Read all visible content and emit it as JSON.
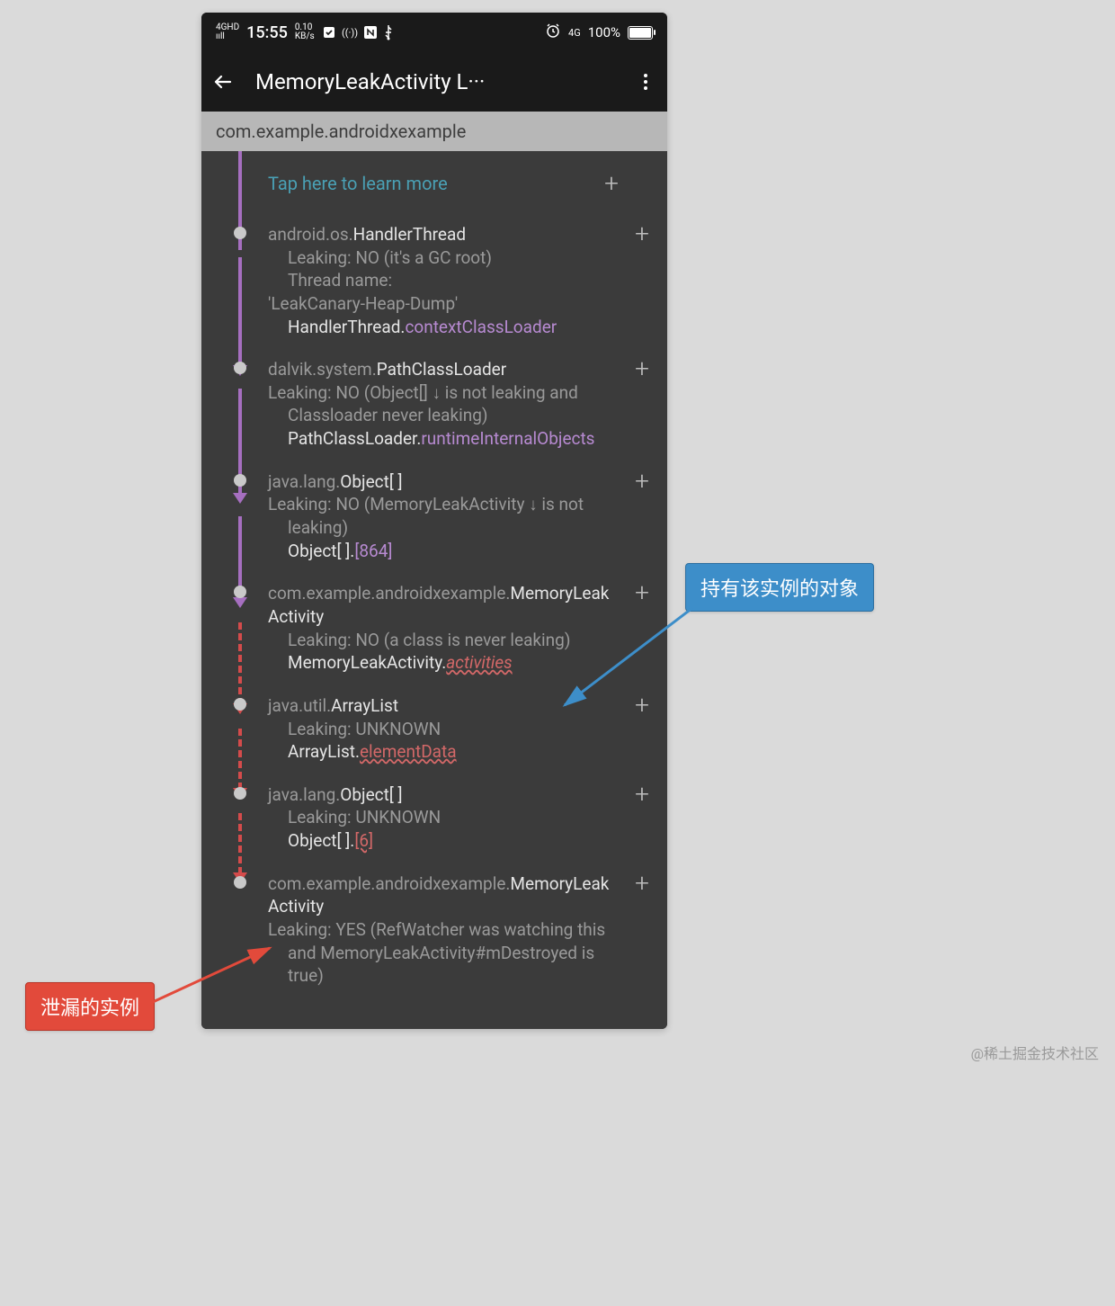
{
  "status": {
    "signal": "4GHD",
    "bars": "ııll",
    "time": "15:55",
    "speed_top": "0.10",
    "speed_bot": "KB/s",
    "net_label": "4G",
    "battery_pct": "100%"
  },
  "appbar": {
    "title": "MemoryLeakActivity L···"
  },
  "package": "com.example.androidxexample",
  "learn_more": "Tap here to learn more",
  "nodes": [
    {
      "pkg": "android.os.",
      "cls": "HandlerThread",
      "leak": "Leaking: NO (it's a GC root)",
      "extra1": "Thread name:",
      "extra2": "'LeakCanary-Heap-Dump'",
      "ref_cls": "HandlerThread.",
      "ref_field": "contextClassLoader",
      "ref_style": "purple"
    },
    {
      "pkg": "dalvik.system.",
      "cls": "PathClassLoader",
      "leak": "Leaking: NO (Object[] ↓ is not leaking and Classloader never leaking)",
      "ref_cls": "PathClassLoader.",
      "ref_field": "runtimeInternalObjects",
      "ref_style": "purple",
      "ref_wrap": true
    },
    {
      "pkg": "java.lang.",
      "cls": "Object[ ]",
      "leak": "Leaking: NO (MemoryLeakActivity ↓ is not leaking)",
      "ref_cls": "Object[ ].",
      "ref_field": "[864]",
      "ref_style": "idx-purple"
    },
    {
      "pkg": "com.example.androidxexample.",
      "cls": "MemoryLeakActivity",
      "leak": "Leaking: NO (a class is never leaking)",
      "ref_cls": "MemoryLeakActivity.",
      "ref_field": "activities",
      "ref_style": "red-italic"
    },
    {
      "pkg": "java.util.",
      "cls": "ArrayList",
      "leak": "Leaking: UNKNOWN",
      "ref_cls": "ArrayList.",
      "ref_field": "elementData",
      "ref_style": "red"
    },
    {
      "pkg": "java.lang.",
      "cls": "Object[ ]",
      "leak": "Leaking: UNKNOWN",
      "ref_cls": "Object[ ].",
      "ref_field": "[6]",
      "ref_style": "idx-red"
    },
    {
      "pkg": "com.example.androidxexample.",
      "cls": "MemoryLeakActivity",
      "leak": "Leaking: YES (RefWatcher was watching this and MemoryLeakActivity#mDestroyed is true)",
      "no_ref": true
    }
  ],
  "annotations": {
    "holder": "持有该实例的对象",
    "leaked": "泄漏的实例"
  },
  "watermark": "@稀土掘金技术社区"
}
